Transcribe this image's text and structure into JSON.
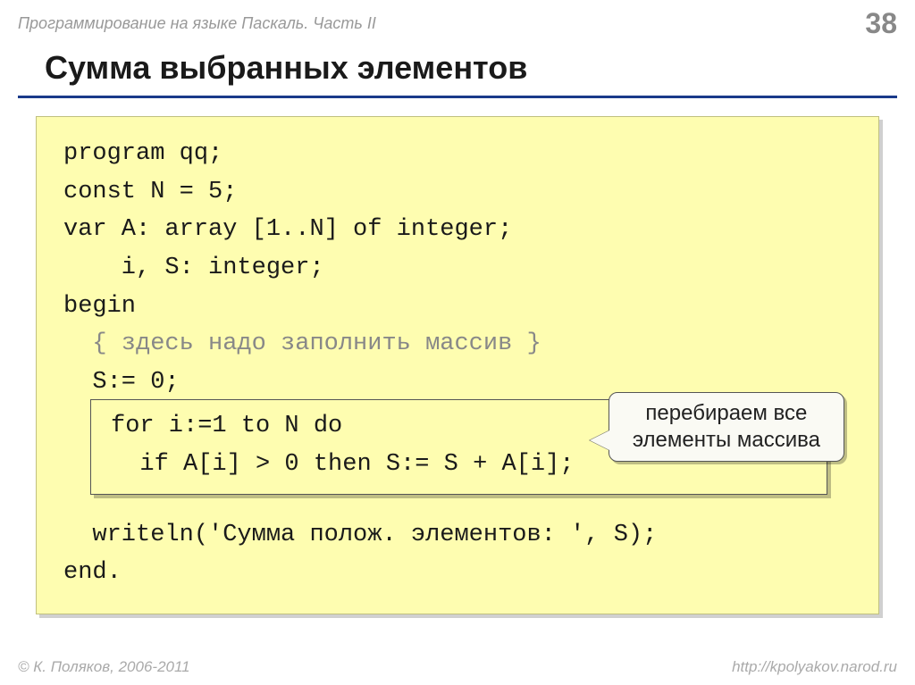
{
  "header": {
    "breadcrumb": "Программирование на языке Паскаль. Часть II",
    "page_number": "38"
  },
  "title": "Сумма выбранных элементов",
  "code": {
    "line1": "program qq;",
    "line2": "const N = 5;",
    "line3": "var A: array [1..N] of integer;",
    "line4": "    i, S: integer;",
    "line5": "begin",
    "line6_comment": "  { здесь надо заполнить массив }",
    "line7": "  S:= 0;",
    "highlight_line1": "for i:=1 to N do",
    "highlight_line2": "  if A[i] > 0 then S:= S + A[i];",
    "line10": "  writeln('Сумма полож. элементов: ', S);",
    "line11": "end."
  },
  "callout": {
    "line1": "перебираем все",
    "line2": "элементы массива"
  },
  "footer": {
    "copyright": "© К. Поляков, 2006-2011",
    "url": "http://kpolyakov.narod.ru"
  }
}
